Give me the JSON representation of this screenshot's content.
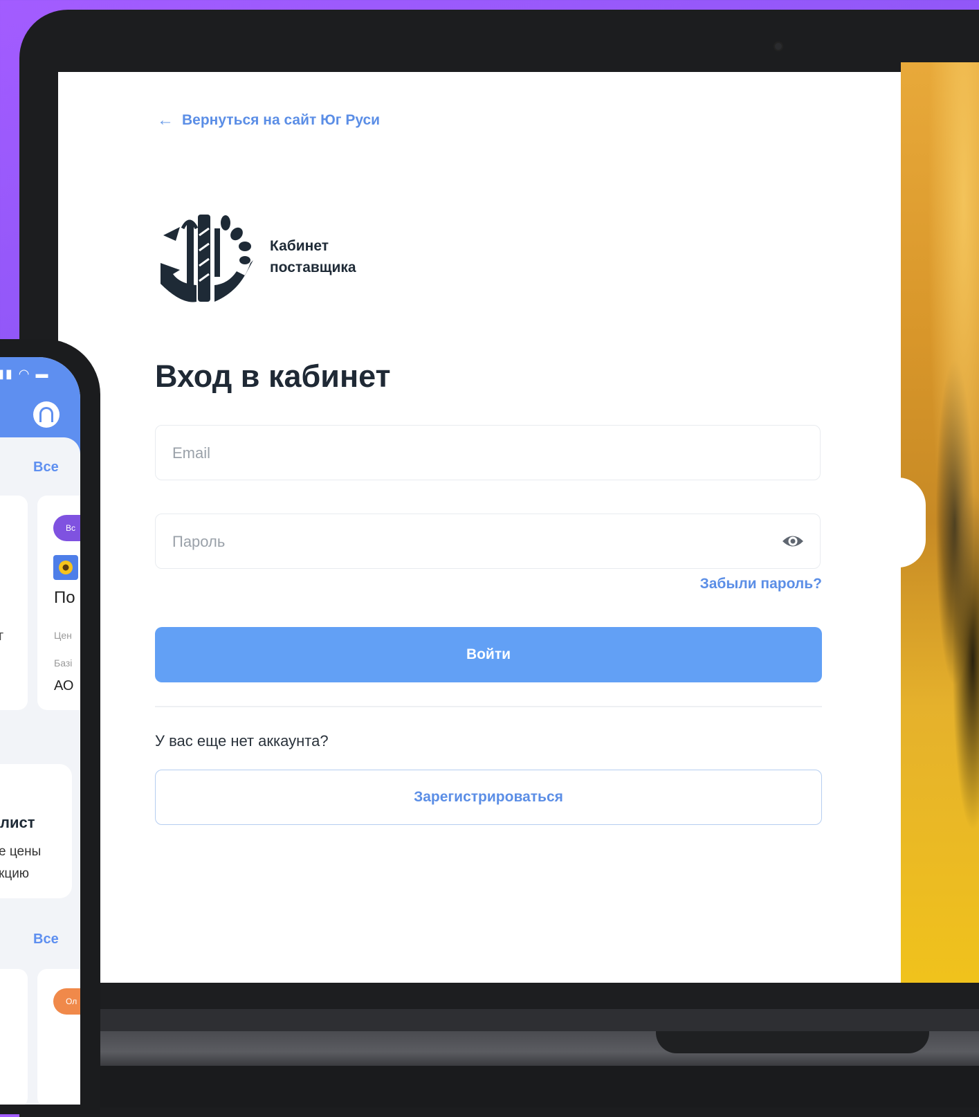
{
  "login": {
    "back_link": "Вернуться на сайт Юг Руси",
    "logo_line1": "Кабинет",
    "logo_line2": "поставщика",
    "title": "Вход в кабинет",
    "email_placeholder": "Email",
    "password_placeholder": "Пароль",
    "forgot": "Забыли пароль?",
    "login_button": "Войти",
    "no_account": "У вас еще нет аккаунта?",
    "register_button": "Зарегистрироваться"
  },
  "phone": {
    "all_link_1": "Все",
    "all_link_2": "Все",
    "pill_purple": "Вс",
    "pill_orange": "Ол",
    "card_title_fragment": "По",
    "label_price_fragment": "Цен",
    "label_base_fragment": "Базі",
    "company_fragment": "АО",
    "left_fragment": "г",
    "list_title_fragment": "лист",
    "list_line1_fragment": "е цены",
    "list_line2_fragment": "кцию"
  },
  "colors": {
    "accent": "#5b8ee6",
    "button": "#62a0f5",
    "background_gradient_start": "#a35cff",
    "background_gradient_end": "#5b3fc9"
  },
  "icons": {
    "back": "arrow-left-icon",
    "eye": "eye-icon",
    "headset": "headset-icon",
    "logo": "wheat-anchor-logo"
  }
}
